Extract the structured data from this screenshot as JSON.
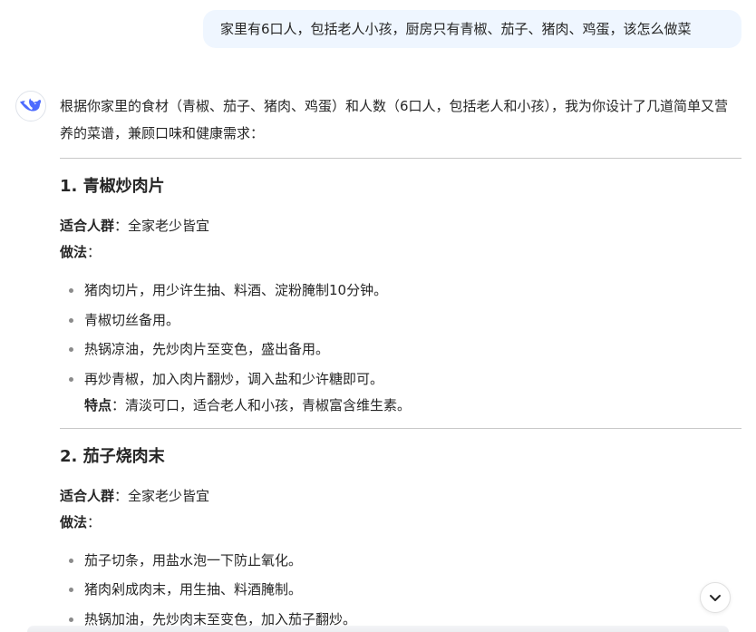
{
  "user_message": "家里有6口人，包括老人小孩，厨房只有青椒、茄子、猪肉、鸡蛋，该怎么做菜",
  "assistant": {
    "avatar_icon": "deepseek-whale-logo",
    "accent_color": "#4d6bfe",
    "intro": "根据你家里的食材（青椒、茄子、猪肉、鸡蛋）和人数（6口人，包括老人和小孩），我为你设计了几道简单又营养的菜谱，兼顾口味和健康需求：",
    "recipes": [
      {
        "title": "1. 青椒炒肉片",
        "audience_label": "适合人群",
        "audience_value": "：全家老少皆宜",
        "method_label": "做法",
        "method_suffix": "：",
        "steps": [
          "猪肉切片，用少许生抽、料酒、淀粉腌制10分钟。",
          "青椒切丝备用。",
          "热锅凉油，先炒肉片至变色，盛出备用。",
          "再炒青椒，加入肉片翻炒，调入盐和少许糖即可。"
        ],
        "feature_label": "特点",
        "feature_value": "：清淡可口，适合老人和小孩，青椒富含维生素。"
      },
      {
        "title": "2. 茄子烧肉末",
        "audience_label": "适合人群",
        "audience_value": "：全家老少皆宜",
        "method_label": "做法",
        "method_suffix": "：",
        "steps": [
          "茄子切条，用盐水泡一下防止氧化。",
          "猪肉剁成肉末，用生抽、料酒腌制。",
          "热锅加油，先炒肉末至变色，加入茄子翻炒。"
        ]
      }
    ]
  },
  "scroll_button_icon": "chevron-down-icon"
}
